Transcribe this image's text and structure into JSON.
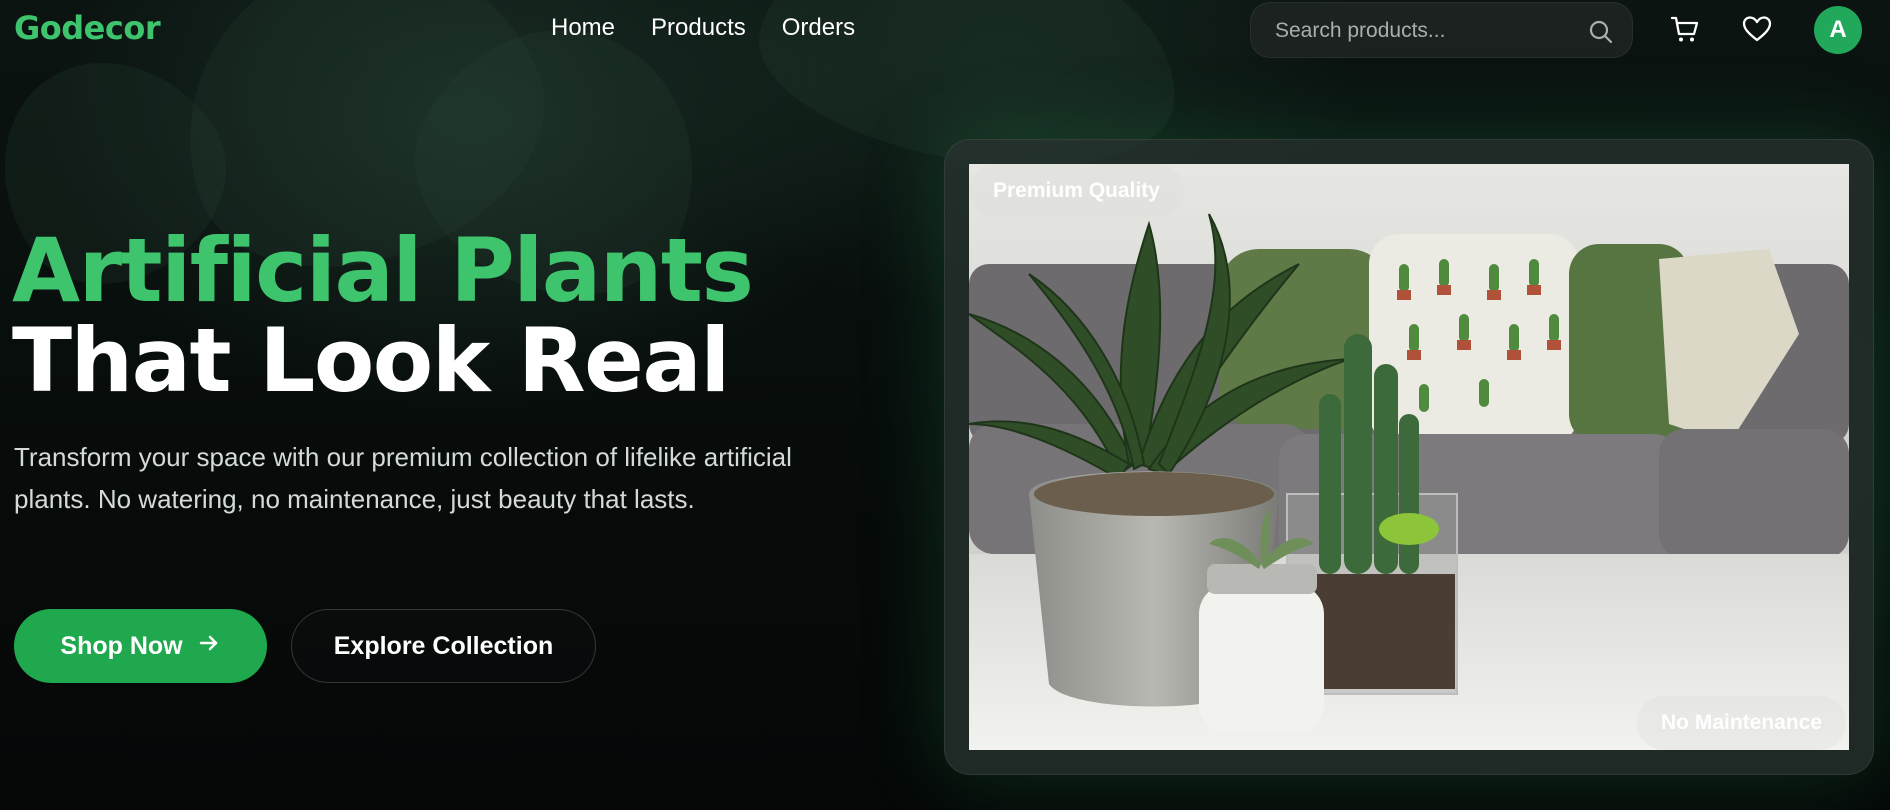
{
  "nav": {
    "brand": "Godecor",
    "links": [
      "Home",
      "Products",
      "Orders"
    ],
    "search_placeholder": "Search products...",
    "icons": {
      "search": "search-icon",
      "cart": "cart-icon",
      "wishlist": "heart-icon"
    },
    "avatar_initial": "A"
  },
  "hero": {
    "title_line1": "Artificial Plants",
    "title_line2": "That Look Real",
    "description": "Transform your space with our premium collection of lifelike artificial plants. No watering, no maintenance, just beauty that lasts.",
    "primary_button": "Shop Now",
    "primary_button_icon": "arrow-right-icon",
    "secondary_button": "Explore Collection"
  },
  "showcase": {
    "badge_top": "Premium Quality",
    "badge_bottom": "No Maintenance"
  },
  "colors": {
    "accent": "#3ec46d",
    "button": "#1fa84d",
    "background": "#06090a"
  }
}
